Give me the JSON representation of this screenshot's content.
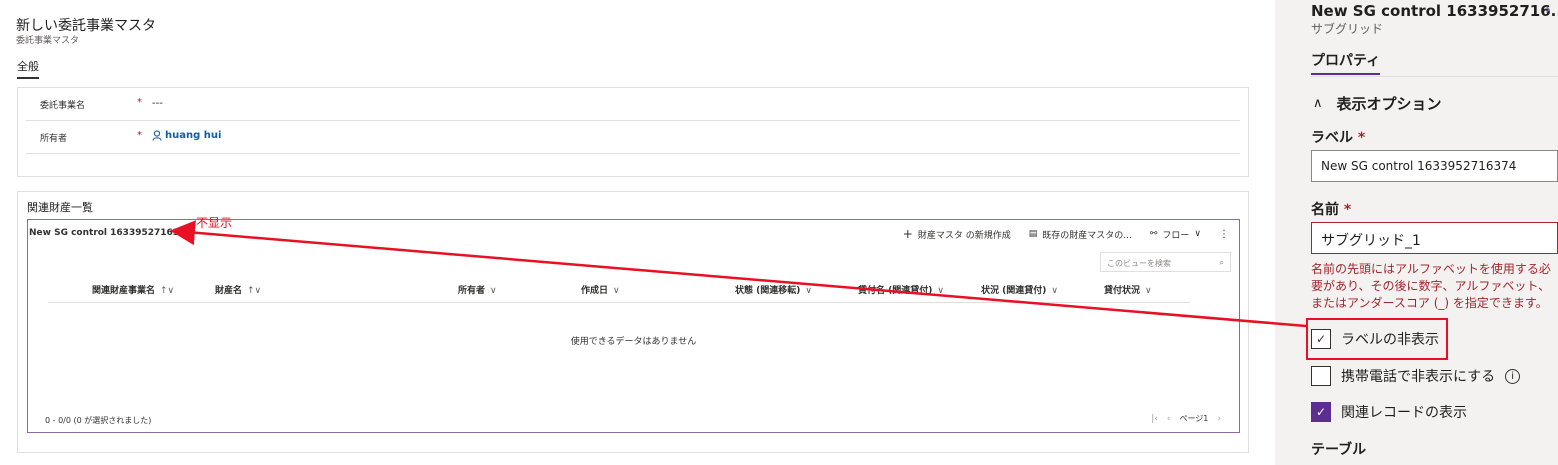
{
  "form": {
    "title": "新しい委託事業マスタ",
    "subtitle": "委託事業マスタ",
    "tab": "全般",
    "fields": [
      {
        "label": "委託事業名",
        "required": "*",
        "value": "---"
      },
      {
        "label": "所有者",
        "required": "*",
        "value": "huang hui"
      }
    ],
    "section_title": "関連財産一覧"
  },
  "subgrid": {
    "label": "New SG control 1633952716374",
    "commands": {
      "new": "財産マスタ の新規作成",
      "existing": "既存の財産マスタの...",
      "flow": "フロー"
    },
    "search_placeholder": "このビューを検索",
    "columns": [
      "関連財産事業名",
      "財産名",
      "所有者",
      "作成日",
      "状態 (関連移転)",
      "貸付名 (関連貸付)",
      "状況 (関連貸付)",
      "貸付状況"
    ],
    "empty_message": "使用できるデータはありません",
    "footer_count": "0 - 0/0 (0 が選択されました)",
    "page_label": "ページ1"
  },
  "annotation": {
    "text": "不显示",
    "color": "#e81123"
  },
  "panel": {
    "title": "New SG control 1633952716...",
    "subtitle": "サブグリッド",
    "tab": "プロパティ",
    "section": "表示オプション",
    "label_caption": "ラベル",
    "label_value": "New SG control 1633952716374",
    "name_caption": "名前",
    "required": "*",
    "name_value": "サブグリッド_1",
    "error": "名前の先頭にはアルファベットを使用する必要があり、その後に数字、アルファベット、またはアンダースコア (_) を指定できます。",
    "checkboxes": [
      {
        "label": "ラベルの非表示",
        "checked": false
      },
      {
        "label": "携帯電話で非表示にする",
        "checked": false
      },
      {
        "label": "関連レコードの表示",
        "checked": true
      }
    ],
    "table_caption": "テーブル",
    "accent_color": "#5c2e91"
  }
}
